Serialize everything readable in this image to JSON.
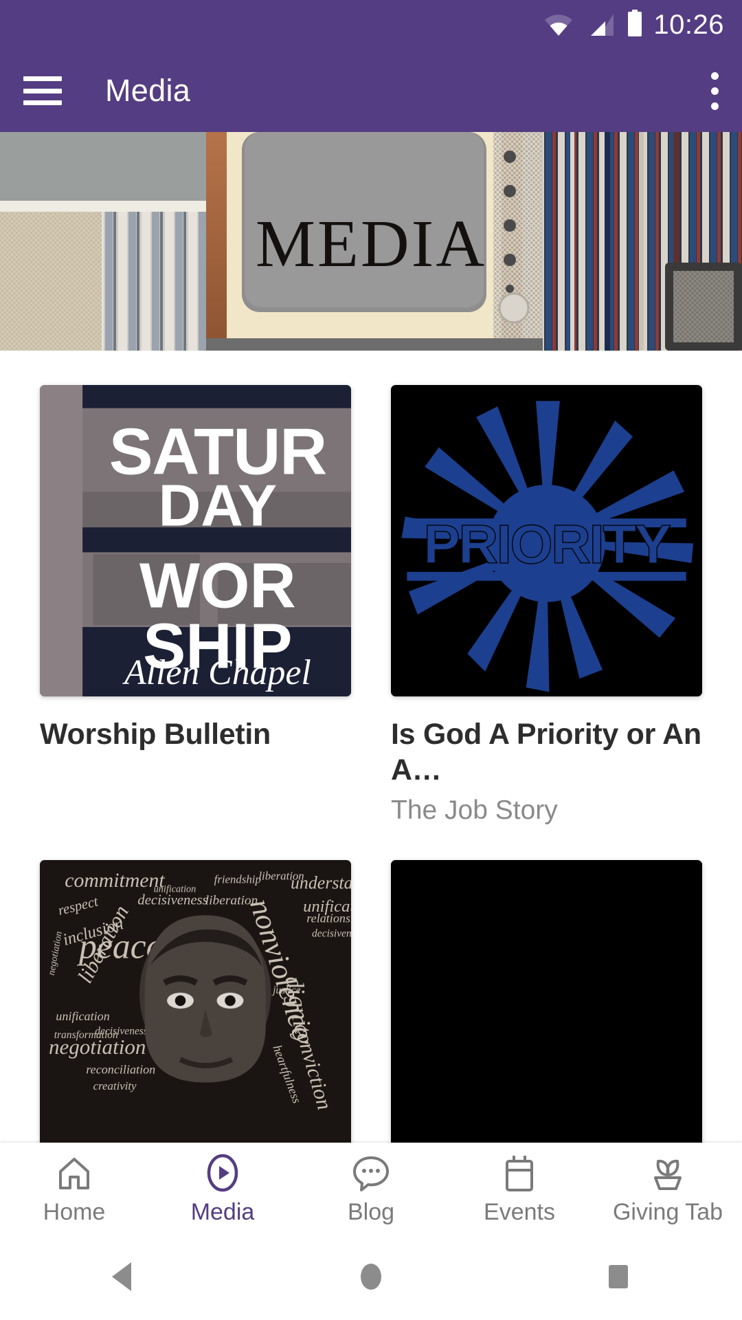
{
  "status_bar": {
    "time": "10:26",
    "icons": [
      "wifi-icon",
      "cellular-signal-icon",
      "battery-icon"
    ]
  },
  "app_bar": {
    "menu_icon": "hamburger-menu-icon",
    "title": "Media",
    "overflow_icon": "more-options-icon"
  },
  "hero": {
    "label": "MEDIA",
    "description": "vintage television surrounded by VHS tapes and records"
  },
  "media_items": [
    {
      "title": "Worship Bulletin",
      "subtitle": "",
      "thumbnail": {
        "type": "saturday-worship-poster",
        "lines": [
          "SATUR",
          "DAY",
          "WOR",
          "SHIP"
        ],
        "script_text": "Allen Chapel",
        "band_color": "#1b2035",
        "frame_color": "#8b8184"
      }
    },
    {
      "title": "Is God A Priority or An A…",
      "subtitle": "The Job Story",
      "thumbnail": {
        "type": "priority-starburst",
        "word": "PRIORITY",
        "background": "#000000",
        "accent": "#1d3f8f"
      }
    },
    {
      "title": "",
      "subtitle": "",
      "thumbnail": {
        "type": "mlk-word-cloud",
        "words": [
          "commitment",
          "understanding",
          "peace",
          "liberation",
          "respect",
          "inclusion",
          "negotiation",
          "unification",
          "decisiveness",
          "friendship",
          "nonviolence",
          "conviction",
          "justice",
          "dignity",
          "relationship",
          "reconciliation",
          "creativity"
        ],
        "background": "#1a1512"
      }
    },
    {
      "title": "",
      "subtitle": "",
      "thumbnail": {
        "type": "black-placeholder",
        "background": "#000000"
      }
    }
  ],
  "tab_bar": {
    "active": "Media",
    "tabs": [
      {
        "label": "Home",
        "icon": "home-icon"
      },
      {
        "label": "Media",
        "icon": "play-circle-icon"
      },
      {
        "label": "Blog",
        "icon": "chat-bubble-icon"
      },
      {
        "label": "Events",
        "icon": "calendar-icon"
      },
      {
        "label": "Giving Tab",
        "icon": "plant-pot-icon"
      }
    ]
  },
  "system_nav": {
    "back": "back-triangle-icon",
    "home": "home-circle-icon",
    "recents": "recents-square-icon"
  },
  "colors": {
    "primary": "#543d82",
    "title_text": "#2d2d2d",
    "subtitle_text": "#8a8a8a",
    "tab_inactive": "#7a7a7a"
  }
}
